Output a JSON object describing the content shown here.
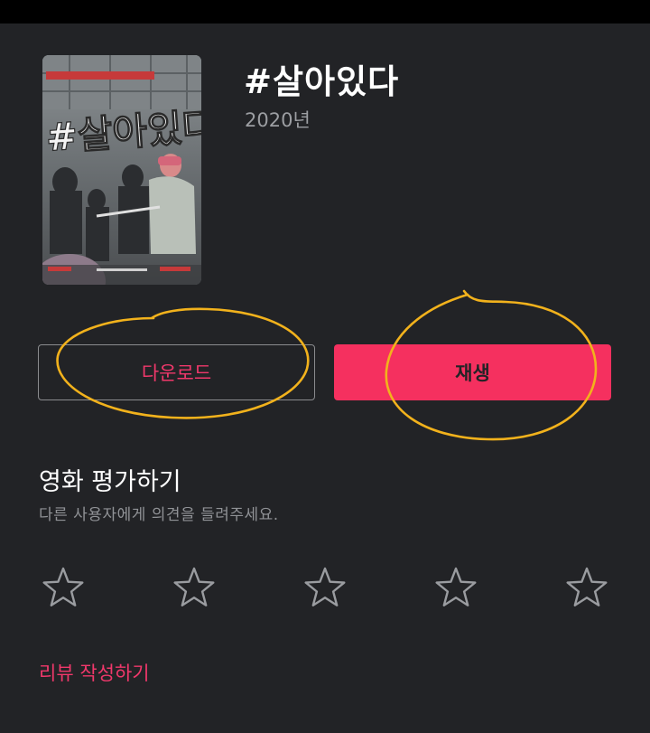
{
  "movie": {
    "title": "#살아있다",
    "year": "2020년",
    "poster_icon": "movie-poster-image",
    "poster_text": "#살아있다"
  },
  "actions": {
    "download_label": "다운로드",
    "play_label": "재생"
  },
  "rating": {
    "title": "영화 평가하기",
    "subtitle": "다른 사용자에게 의견을 들려주세요.",
    "max_stars": 5,
    "selected_stars": 0,
    "star_icon": "star-outline-icon"
  },
  "review": {
    "link_label": "리뷰 작성하기"
  },
  "colors": {
    "background": "#222326",
    "accent": "#f5305f",
    "accent_text": "#f0386b",
    "annotation": "#f2b21c",
    "muted_text": "#909296"
  }
}
